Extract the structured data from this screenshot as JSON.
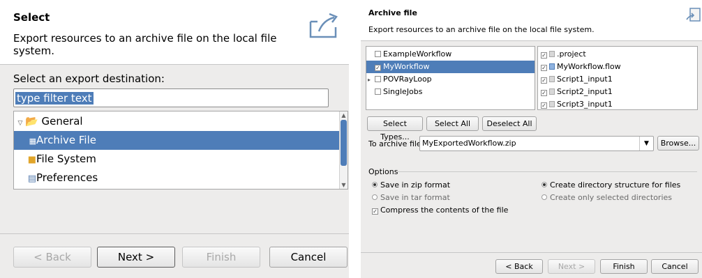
{
  "left": {
    "title": "Select",
    "description": "Export resources to an archive file on the local file system.",
    "dest_label": "Select an export destination:",
    "filter_value": "type filter text",
    "tree": [
      {
        "label": "General",
        "icon": "folder-open-icon",
        "expanded": true
      },
      {
        "label": "Archive File",
        "icon": "archive-icon",
        "selected": true
      },
      {
        "label": "File System",
        "icon": "folder-icon"
      },
      {
        "label": "Preferences",
        "icon": "preferences-icon"
      }
    ],
    "buttons": {
      "back": "< Back",
      "next": "Next >",
      "finish": "Finish",
      "cancel": "Cancel"
    }
  },
  "right": {
    "title": "Archive file",
    "description": "Export resources to an archive file on the local file system.",
    "projects": [
      {
        "label": "ExampleWorkflow",
        "checked": false
      },
      {
        "label": "MyWorkflow",
        "checked": true,
        "selected": true
      },
      {
        "label": "POVRayLoop",
        "checked": false,
        "collapsed": true
      },
      {
        "label": "SingleJobs",
        "checked": false
      }
    ],
    "files": [
      {
        "label": ".project",
        "checked": true
      },
      {
        "label": "MyWorkflow.flow",
        "checked": true
      },
      {
        "label": "Script1_input1",
        "checked": true
      },
      {
        "label": "Script2_input1",
        "checked": true
      },
      {
        "label": "Script3_input1",
        "checked": true
      }
    ],
    "buttons": {
      "select_types": "Select Types...",
      "select_all": "Select All",
      "deselect_all": "Deselect All",
      "browse": "Browse...",
      "back": "< Back",
      "next": "Next >",
      "finish": "Finish",
      "cancel": "Cancel"
    },
    "to_archive_label": "To archive file:",
    "archive_value": "MyExportedWorkflow.zip",
    "options_title": "Options",
    "options": {
      "zip": "Save in zip format",
      "tar": "Save in tar format",
      "compress": "Compress the contents of the file",
      "dir_structure": "Create directory structure for files",
      "selected_dirs": "Create only selected directories"
    }
  },
  "colors": {
    "selection": "#4e7db8",
    "dialog_bg": "#edeceb"
  }
}
